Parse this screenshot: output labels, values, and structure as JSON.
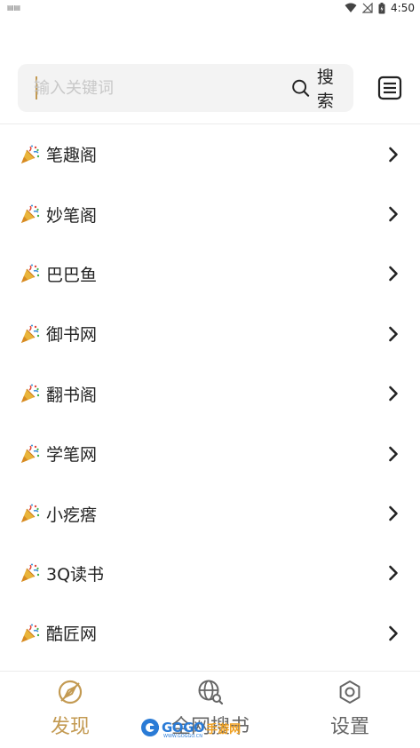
{
  "status_bar": {
    "left_indicator": "▤▤",
    "time": "4:50"
  },
  "search": {
    "placeholder": "输入关键词",
    "button_label": "搜索"
  },
  "sites": [
    {
      "label": "笔趣阁"
    },
    {
      "label": "妙笔阁"
    },
    {
      "label": "巴巴鱼"
    },
    {
      "label": "御书网"
    },
    {
      "label": "翻书阁"
    },
    {
      "label": "学笔网"
    },
    {
      "label": "小疙瘩"
    },
    {
      "label": "3Q读书"
    },
    {
      "label": "酷匠网"
    }
  ],
  "site_icon": "party-popper-icon",
  "bottom_nav": {
    "discover": "发现",
    "web_search": "全网搜书",
    "settings": "设置"
  },
  "watermark": {
    "brand": "GOGO",
    "sub": "手游网",
    "url": "WWW.GOGGO.CN"
  },
  "colors": {
    "accent": "#c39a52",
    "text": "#222222",
    "muted": "#666666",
    "search_bg": "#f3f3f3"
  }
}
